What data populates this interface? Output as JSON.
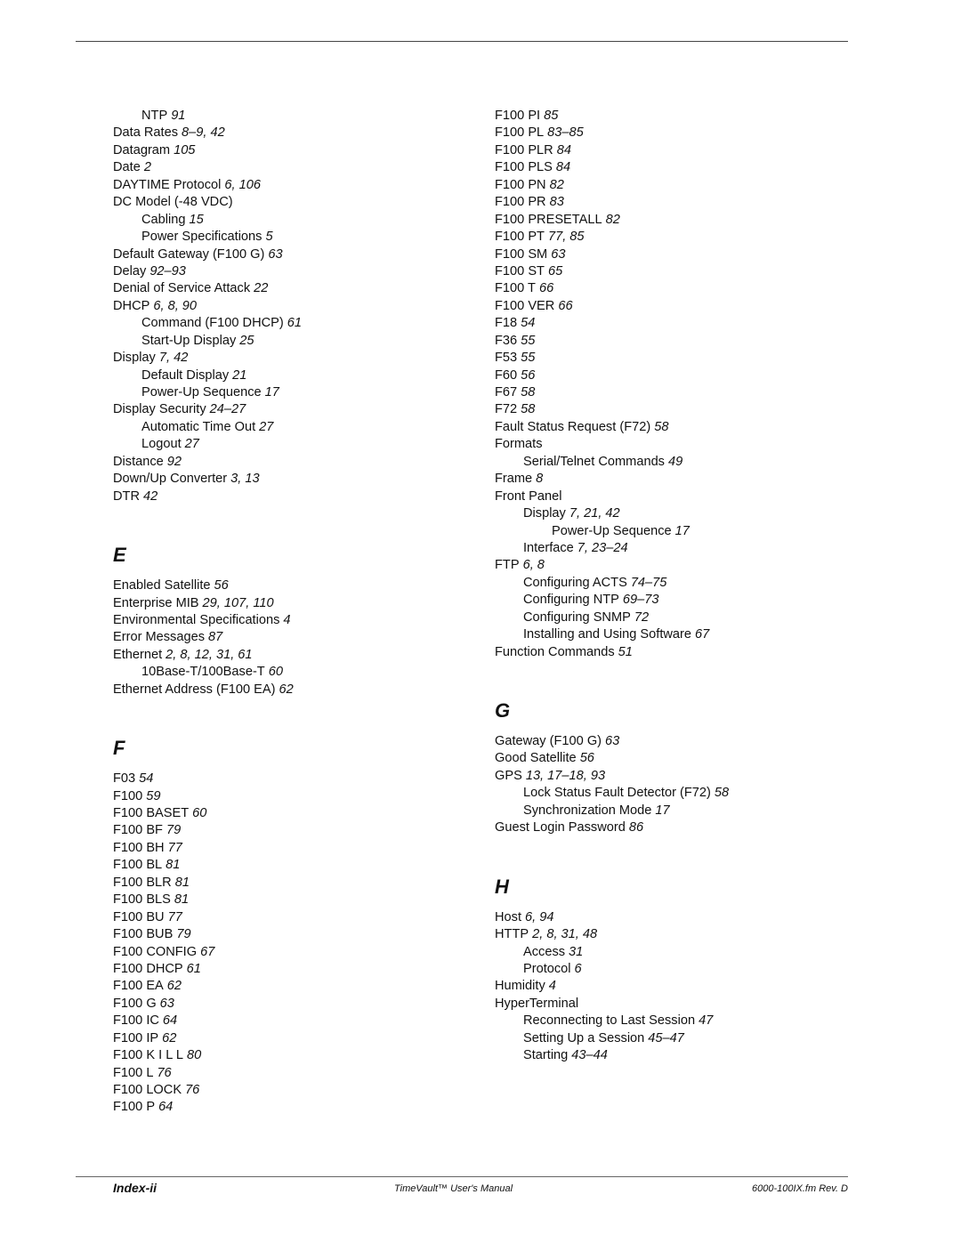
{
  "left_column": [
    {
      "type": "entry",
      "level": 2,
      "term": "NTP",
      "pages": "91"
    },
    {
      "type": "entry",
      "level": 1,
      "term": "Data Rates",
      "pages": "8‒9, 42"
    },
    {
      "type": "entry",
      "level": 1,
      "term": "Datagram",
      "pages": "105"
    },
    {
      "type": "entry",
      "level": 1,
      "term": "Date",
      "pages": "2"
    },
    {
      "type": "entry",
      "level": 1,
      "term": "DAYTIME Protocol",
      "pages": "6, 106"
    },
    {
      "type": "entry",
      "level": 1,
      "term": "DC Model (-48 VDC)",
      "pages": ""
    },
    {
      "type": "entry",
      "level": 2,
      "term": "Cabling",
      "pages": "15"
    },
    {
      "type": "entry",
      "level": 2,
      "term": "Power Specifications",
      "pages": "5"
    },
    {
      "type": "entry",
      "level": 1,
      "term": "Default Gateway (F100 G)",
      "pages": "63"
    },
    {
      "type": "entry",
      "level": 1,
      "term": "Delay",
      "pages": "92‒93"
    },
    {
      "type": "entry",
      "level": 1,
      "term": "Denial of Service Attack",
      "pages": "22"
    },
    {
      "type": "entry",
      "level": 1,
      "term": "DHCP",
      "pages": "6, 8, 90"
    },
    {
      "type": "entry",
      "level": 2,
      "term": "Command (F100 DHCP)",
      "pages": "61"
    },
    {
      "type": "entry",
      "level": 2,
      "term": "Start-Up Display",
      "pages": "25"
    },
    {
      "type": "entry",
      "level": 1,
      "term": "Display",
      "pages": "7, 42"
    },
    {
      "type": "entry",
      "level": 2,
      "term": "Default Display",
      "pages": "21"
    },
    {
      "type": "entry",
      "level": 2,
      "term": "Power-Up Sequence",
      "pages": "17"
    },
    {
      "type": "entry",
      "level": 1,
      "term": "Display Security",
      "pages": "24‒27"
    },
    {
      "type": "entry",
      "level": 2,
      "term": "Automatic Time Out",
      "pages": "27"
    },
    {
      "type": "entry",
      "level": 2,
      "term": "Logout",
      "pages": "27"
    },
    {
      "type": "entry",
      "level": 1,
      "term": "Distance",
      "pages": "92"
    },
    {
      "type": "entry",
      "level": 1,
      "term": "Down/Up Converter",
      "pages": "3, 13"
    },
    {
      "type": "entry",
      "level": 1,
      "term": "DTR",
      "pages": "42"
    },
    {
      "type": "letter",
      "term": "E"
    },
    {
      "type": "entry",
      "level": 1,
      "term": "Enabled Satellite",
      "pages": "56"
    },
    {
      "type": "entry",
      "level": 1,
      "term": "Enterprise MIB",
      "pages": "29, 107, 110"
    },
    {
      "type": "entry",
      "level": 1,
      "term": "Environmental Specifications",
      "pages": "4"
    },
    {
      "type": "entry",
      "level": 1,
      "term": "Error Messages",
      "pages": "87"
    },
    {
      "type": "entry",
      "level": 1,
      "term": "Ethernet",
      "pages": "2, 8, 12, 31, 61"
    },
    {
      "type": "entry",
      "level": 2,
      "term": "10Base-T/100Base-T",
      "pages": "60"
    },
    {
      "type": "entry",
      "level": 1,
      "term": "Ethernet Address (F100 EA)",
      "pages": "62"
    },
    {
      "type": "letter",
      "term": "F"
    },
    {
      "type": "entry",
      "level": 1,
      "term": "F03",
      "pages": "54"
    },
    {
      "type": "entry",
      "level": 1,
      "term": "F100",
      "pages": "59"
    },
    {
      "type": "entry",
      "level": 1,
      "term": "F100 BASET",
      "pages": "60"
    },
    {
      "type": "entry",
      "level": 1,
      "term": "F100 BF",
      "pages": "79"
    },
    {
      "type": "entry",
      "level": 1,
      "term": "F100 BH",
      "pages": "77"
    },
    {
      "type": "entry",
      "level": 1,
      "term": "F100 BL",
      "pages": "81"
    },
    {
      "type": "entry",
      "level": 1,
      "term": "F100 BLR",
      "pages": "81"
    },
    {
      "type": "entry",
      "level": 1,
      "term": "F100 BLS",
      "pages": "81"
    },
    {
      "type": "entry",
      "level": 1,
      "term": "F100 BU",
      "pages": "77"
    },
    {
      "type": "entry",
      "level": 1,
      "term": "F100 BUB",
      "pages": "79"
    },
    {
      "type": "entry",
      "level": 1,
      "term": "F100 CONFIG",
      "pages": "67"
    },
    {
      "type": "entry",
      "level": 1,
      "term": "F100 DHCP",
      "pages": "61"
    },
    {
      "type": "entry",
      "level": 1,
      "term": "F100 EA",
      "pages": "62"
    },
    {
      "type": "entry",
      "level": 1,
      "term": "F100 G",
      "pages": "63"
    },
    {
      "type": "entry",
      "level": 1,
      "term": "F100 IC",
      "pages": "64"
    },
    {
      "type": "entry",
      "level": 1,
      "term": "F100 IP",
      "pages": "62"
    },
    {
      "type": "entry",
      "level": 1,
      "term": "F100 K I L L",
      "pages": "80"
    },
    {
      "type": "entry",
      "level": 1,
      "term": "F100 L",
      "pages": "76"
    },
    {
      "type": "entry",
      "level": 1,
      "term": "F100 LOCK",
      "pages": "76"
    },
    {
      "type": "entry",
      "level": 1,
      "term": "F100 P",
      "pages": "64"
    }
  ],
  "right_column": [
    {
      "type": "entry",
      "level": 1,
      "term": "F100 PI",
      "pages": "85"
    },
    {
      "type": "entry",
      "level": 1,
      "term": "F100 PL",
      "pages": "83‒85"
    },
    {
      "type": "entry",
      "level": 1,
      "term": "F100 PLR",
      "pages": "84"
    },
    {
      "type": "entry",
      "level": 1,
      "term": "F100 PLS",
      "pages": "84"
    },
    {
      "type": "entry",
      "level": 1,
      "term": "F100 PN",
      "pages": "82"
    },
    {
      "type": "entry",
      "level": 1,
      "term": "F100 PR",
      "pages": "83"
    },
    {
      "type": "entry",
      "level": 1,
      "term": "F100 PRESETALL",
      "pages": "82"
    },
    {
      "type": "entry",
      "level": 1,
      "term": "F100 PT",
      "pages": "77, 85"
    },
    {
      "type": "entry",
      "level": 1,
      "term": "F100 SM",
      "pages": "63"
    },
    {
      "type": "entry",
      "level": 1,
      "term": "F100 ST",
      "pages": "65"
    },
    {
      "type": "entry",
      "level": 1,
      "term": "F100 T",
      "pages": "66"
    },
    {
      "type": "entry",
      "level": 1,
      "term": "F100 VER",
      "pages": "66"
    },
    {
      "type": "entry",
      "level": 1,
      "term": "F18",
      "pages": "54"
    },
    {
      "type": "entry",
      "level": 1,
      "term": "F36",
      "pages": "55"
    },
    {
      "type": "entry",
      "level": 1,
      "term": "F53",
      "pages": "55"
    },
    {
      "type": "entry",
      "level": 1,
      "term": "F60",
      "pages": "56"
    },
    {
      "type": "entry",
      "level": 1,
      "term": "F67",
      "pages": "58"
    },
    {
      "type": "entry",
      "level": 1,
      "term": "F72",
      "pages": "58"
    },
    {
      "type": "entry",
      "level": 1,
      "term": "Fault Status Request (F72)",
      "pages": "58"
    },
    {
      "type": "entry",
      "level": 1,
      "term": "Formats",
      "pages": ""
    },
    {
      "type": "entry",
      "level": 2,
      "term": "Serial/Telnet Commands",
      "pages": "49"
    },
    {
      "type": "entry",
      "level": 1,
      "term": "Frame",
      "pages": "8"
    },
    {
      "type": "entry",
      "level": 1,
      "term": "Front Panel",
      "pages": ""
    },
    {
      "type": "entry",
      "level": 2,
      "term": "Display",
      "pages": "7, 21, 42"
    },
    {
      "type": "entry",
      "level": 3,
      "term": "Power-Up Sequence",
      "pages": "17"
    },
    {
      "type": "entry",
      "level": 2,
      "term": "Interface",
      "pages": "7, 23‒24"
    },
    {
      "type": "entry",
      "level": 1,
      "term": "FTP",
      "pages": "6, 8"
    },
    {
      "type": "entry",
      "level": 2,
      "term": "Configuring ACTS",
      "pages": "74‒75"
    },
    {
      "type": "entry",
      "level": 2,
      "term": "Configuring NTP",
      "pages": "69‒73"
    },
    {
      "type": "entry",
      "level": 2,
      "term": "Configuring SNMP",
      "pages": "72"
    },
    {
      "type": "entry",
      "level": 2,
      "term": "Installing and Using Software",
      "pages": "67"
    },
    {
      "type": "entry",
      "level": 1,
      "term": "Function Commands",
      "pages": "51"
    },
    {
      "type": "letter",
      "term": "G"
    },
    {
      "type": "entry",
      "level": 1,
      "term": "Gateway (F100 G)",
      "pages": "63"
    },
    {
      "type": "entry",
      "level": 1,
      "term": "Good Satellite",
      "pages": "56"
    },
    {
      "type": "entry",
      "level": 1,
      "term": "GPS",
      "pages": "13, 17‒18, 93"
    },
    {
      "type": "entry",
      "level": 2,
      "term": "Lock Status Fault Detector (F72)",
      "pages": "58"
    },
    {
      "type": "entry",
      "level": 2,
      "term": "Synchronization Mode",
      "pages": "17"
    },
    {
      "type": "entry",
      "level": 1,
      "term": "Guest Login Password",
      "pages": "86"
    },
    {
      "type": "letter",
      "term": "H"
    },
    {
      "type": "entry",
      "level": 1,
      "term": "Host",
      "pages": "6, 94"
    },
    {
      "type": "entry",
      "level": 1,
      "term": "HTTP",
      "pages": "2, 8, 31, 48"
    },
    {
      "type": "entry",
      "level": 2,
      "term": "Access",
      "pages": "31"
    },
    {
      "type": "entry",
      "level": 2,
      "term": "Protocol",
      "pages": "6"
    },
    {
      "type": "entry",
      "level": 1,
      "term": "Humidity",
      "pages": "4"
    },
    {
      "type": "entry",
      "level": 1,
      "term": "HyperTerminal",
      "pages": ""
    },
    {
      "type": "entry",
      "level": 2,
      "term": "Reconnecting to Last Session",
      "pages": "47"
    },
    {
      "type": "entry",
      "level": 2,
      "term": "Setting Up a Session",
      "pages": "45‒47"
    },
    {
      "type": "entry",
      "level": 2,
      "term": "Starting",
      "pages": "43‒44"
    }
  ],
  "footer": {
    "page_label": "Index-ii",
    "manual_title": "TimeVault™ User's Manual",
    "file_rev": "6000-100IX.fm  Rev. D"
  }
}
